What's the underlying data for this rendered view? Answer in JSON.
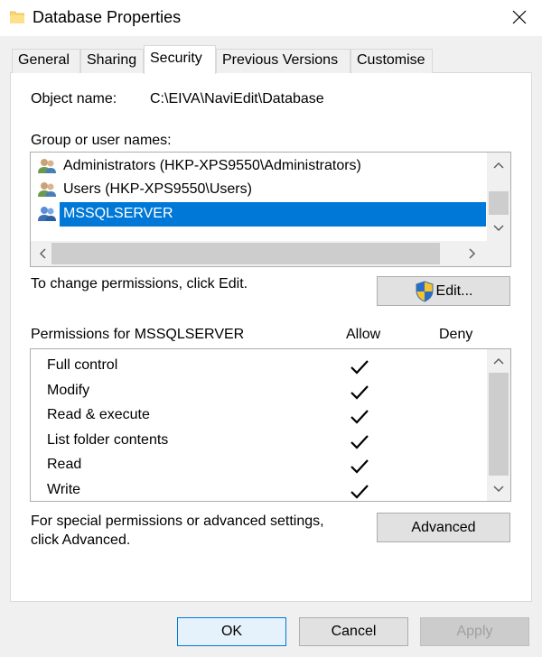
{
  "window": {
    "title": "Database Properties"
  },
  "tabs": [
    {
      "label": "General"
    },
    {
      "label": "Sharing"
    },
    {
      "label": "Security"
    },
    {
      "label": "Previous Versions"
    },
    {
      "label": "Customise"
    }
  ],
  "security": {
    "object_name_label": "Object name:",
    "object_name_value": "C:\\EIVA\\NaviEdit\\Database",
    "group_label": "Group or user names:",
    "groups": [
      {
        "name": "Administrators (HKP-XPS9550\\Administrators)"
      },
      {
        "name": "Users (HKP-XPS9550\\Users)"
      },
      {
        "name": "MSSQLSERVER"
      }
    ],
    "change_hint": "To change permissions, click Edit.",
    "edit_label": "Edit...",
    "perm_title": "Permissions for MSSQLSERVER",
    "allow_header": "Allow",
    "deny_header": "Deny",
    "permissions": [
      {
        "name": "Full control",
        "allow": true,
        "deny": false
      },
      {
        "name": "Modify",
        "allow": true,
        "deny": false
      },
      {
        "name": "Read & execute",
        "allow": true,
        "deny": false
      },
      {
        "name": "List folder contents",
        "allow": true,
        "deny": false
      },
      {
        "name": "Read",
        "allow": true,
        "deny": false
      },
      {
        "name": "Write",
        "allow": true,
        "deny": false
      }
    ],
    "special_text_1": "For special permissions or advanced settings,",
    "special_text_2": "click Advanced.",
    "advanced_label": "Advanced"
  },
  "footer": {
    "ok": "OK",
    "cancel": "Cancel",
    "apply": "Apply"
  },
  "colors": {
    "selection": "#0078d7",
    "window_bg": "#f0f0f0",
    "focus_border": "#0078d7"
  }
}
